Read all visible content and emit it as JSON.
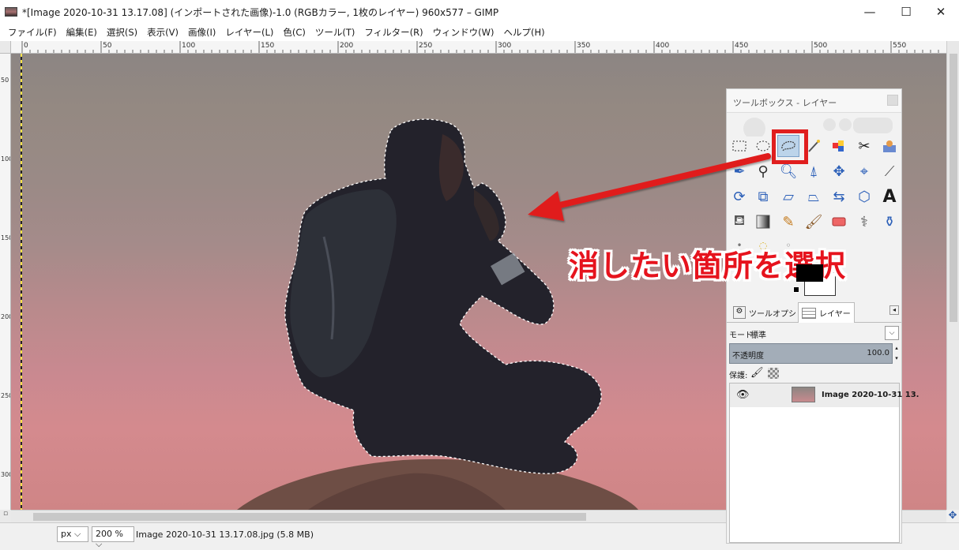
{
  "window": {
    "title": "*[Image 2020-10-31 13.17.08] (インポートされた画像)-1.0 (RGBカラー, 1枚のレイヤー) 960x577 – GIMP",
    "minimize": "—",
    "maximize": "☐",
    "close": "✕"
  },
  "menu": [
    "ファイル(F)",
    "編集(E)",
    "選択(S)",
    "表示(V)",
    "画像(I)",
    "レイヤー(L)",
    "色(C)",
    "ツール(T)",
    "フィルター(R)",
    "ウィンドウ(W)",
    "ヘルプ(H)"
  ],
  "ruler": {
    "h_labels": [
      "0",
      "50",
      "100",
      "150",
      "200",
      "250",
      "300",
      "350",
      "400",
      "450",
      "500",
      "550"
    ],
    "v_labels": [
      "50",
      "100",
      "150",
      "200",
      "250",
      "300"
    ]
  },
  "toolbox": {
    "title": "ツールボックス - レイヤー",
    "tools_row1": [
      "rect-select",
      "ellipse-select",
      "free-select",
      "fuzzy-select",
      "color-select",
      "scissors",
      "foreground-select"
    ],
    "selected_tool": "free-select"
  },
  "tabs": {
    "tool_options": "ツールオプション",
    "layers": "レイヤー"
  },
  "layers_panel": {
    "mode_label": "モード:",
    "mode_value": "標準",
    "opacity_label": "不透明度",
    "opacity_value": "100.0",
    "lock_label": "保護:",
    "layer_name": "Image 2020-10-31 13."
  },
  "status": {
    "unit": "px",
    "zoom": "200 %",
    "file_info": "Image 2020-10-31 13.17.08.jpg (5.8 MB)"
  },
  "annotation": {
    "text": "消したい箇所を選択",
    "color": "#e6131d"
  }
}
